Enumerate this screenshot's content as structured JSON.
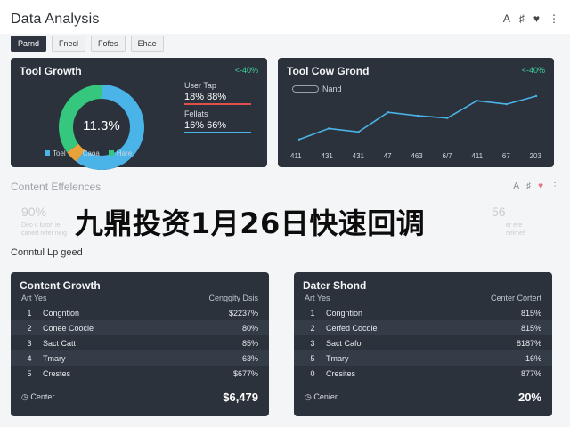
{
  "header": {
    "title": "Data Analysis",
    "icons": [
      "font-icon",
      "bell-icon",
      "heart-icon",
      "settings-icon"
    ]
  },
  "tabs": [
    {
      "label": "Parnd",
      "active": true
    },
    {
      "label": "Fnecl",
      "active": false
    },
    {
      "label": "Fofes",
      "active": false
    },
    {
      "label": "Ehae",
      "active": false
    }
  ],
  "card_growth": {
    "title": "Tool Growth",
    "badge": "<-40%",
    "donut_label": "11.3%",
    "legend": [
      {
        "label": "Toel",
        "color": "#4ab3e8"
      },
      {
        "label": "Caoa",
        "color": "#e8a23c"
      },
      {
        "label": "Hare",
        "color": "#36c77e"
      }
    ],
    "stat1_label": "User Tap",
    "stat1_value": "18% 88%",
    "stat2_label": "Fellats",
    "stat2_value": "16% 66%"
  },
  "card_line": {
    "title": "Tool Cow Grond",
    "badge": "<-40%",
    "legend_label": "Nand",
    "x_ticks": [
      "411",
      "431",
      "431",
      "47",
      "463",
      "6/7",
      "411",
      "67",
      "203"
    ]
  },
  "chart_data": [
    {
      "type": "pie",
      "title": "Tool Growth",
      "labels": [
        "Toel",
        "Caoa",
        "Hare"
      ],
      "values": [
        60,
        5,
        35
      ],
      "colors": [
        "#4ab3e8",
        "#e8a23c",
        "#36c77e"
      ]
    },
    {
      "type": "line",
      "title": "Tool Cow Grond",
      "categories": [
        "411",
        "431",
        "431",
        "47",
        "463",
        "6/7",
        "411",
        "67",
        "203"
      ],
      "series": [
        {
          "name": "Nand",
          "values": [
            5,
            24,
            18,
            52,
            46,
            42,
            72,
            66,
            80
          ]
        }
      ],
      "ylim": [
        0,
        100
      ],
      "grid": false
    }
  ],
  "section": {
    "title": "Content Effelences",
    "faded_left_value": "90%",
    "faded_left_text1": "Deo u luron le",
    "faded_left_text2": "canert refer neig",
    "faded_right_value": "56",
    "faded_right_text1": "er ere",
    "faded_right_text2": "nelmef",
    "icons": [
      "font-icon",
      "bell-icon",
      "heart-icon",
      "settings-icon"
    ]
  },
  "overlay_text": "九鼎投资1月26日快速回调",
  "subhead": "Conntul Lp geed",
  "table_left": {
    "title": "Content Growth",
    "col1": "Art Yes",
    "col2": "Cenggity Dsis",
    "rows": [
      {
        "num": "1",
        "name": "Congntion",
        "val": "$2237%"
      },
      {
        "num": "2",
        "name": "Conee Coocle",
        "val": "80%"
      },
      {
        "num": "3",
        "name": "Sact Catt",
        "val": "85%"
      },
      {
        "num": "4",
        "name": "Tmary",
        "val": "63%"
      },
      {
        "num": "5",
        "name": "Crestes",
        "val": "$677%"
      }
    ],
    "footer_label": "Center",
    "footer_value": "$6,479"
  },
  "table_right": {
    "title": "Dater Shond",
    "col1": "Art Yes",
    "col2": "Center Cortert",
    "rows": [
      {
        "num": "1",
        "name": "Congntion",
        "val": "815%"
      },
      {
        "num": "2",
        "name": "Cerfed Cocdle",
        "val": "815%"
      },
      {
        "num": "3",
        "name": "Sact Cafo",
        "val": "8187%"
      },
      {
        "num": "5",
        "name": "Tmary",
        "val": "16%"
      },
      {
        "num": "0",
        "name": "Cresites",
        "val": "877%"
      }
    ],
    "footer_label": "Cenier",
    "footer_value": "20%"
  }
}
